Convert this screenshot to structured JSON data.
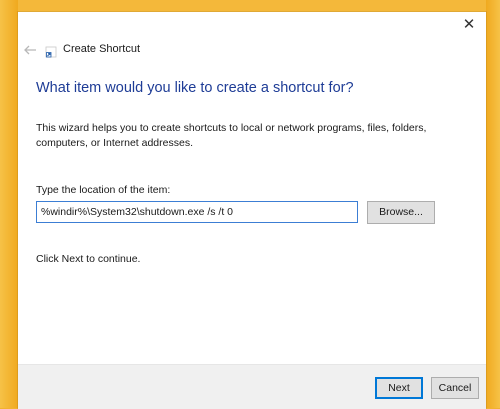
{
  "window": {
    "title": "Create Shortcut",
    "close_glyph": "✕",
    "back_glyph": "←"
  },
  "content": {
    "heading": "What item would you like to create a shortcut for?",
    "description": "This wizard helps you to create shortcuts to local or network programs, files, folders, computers, or Internet addresses.",
    "location_label": "Type the location of the item:",
    "location_value": "%windir%\\System32\\shutdown.exe /s /t 0",
    "browse_label": "Browse...",
    "hint": "Click Next to continue."
  },
  "footer": {
    "next_label": "Next",
    "cancel_label": "Cancel"
  },
  "colors": {
    "heading": "#1e3c96",
    "desktop": "#f2b230",
    "focus_border": "#0078d7"
  },
  "icons": {
    "back": "back-arrow-icon",
    "wizard": "shortcut-icon",
    "close": "close-icon"
  }
}
